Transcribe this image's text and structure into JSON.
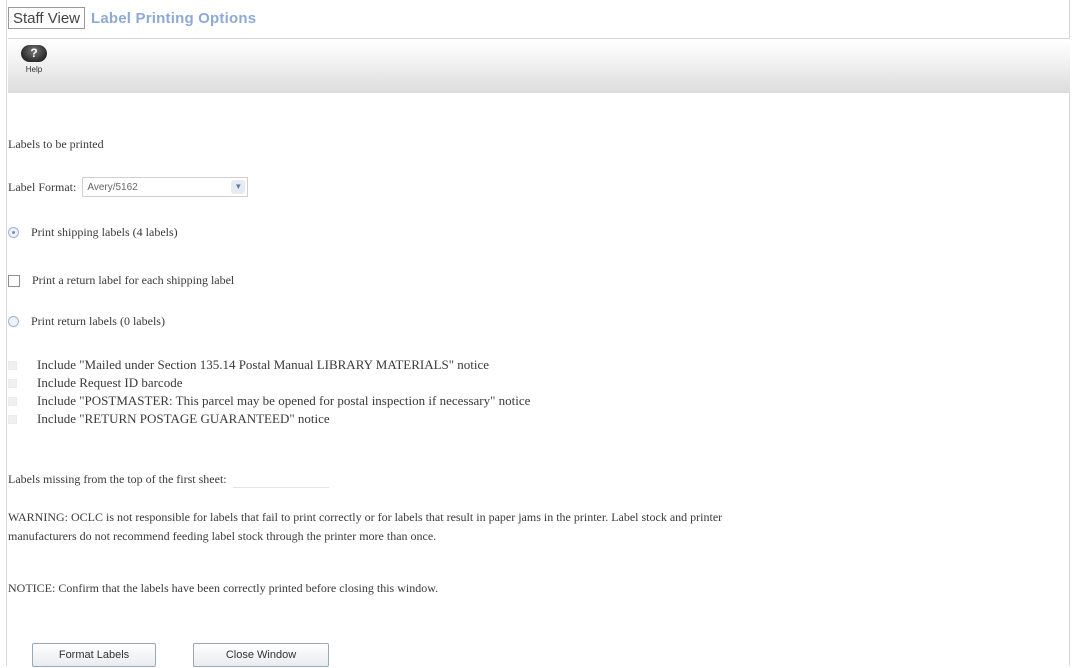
{
  "window": {
    "staff_view_tab": "Staff View",
    "page_title": "Label Printing Options"
  },
  "toolbar": {
    "help_label": "Help",
    "help_icon": "?"
  },
  "form": {
    "labels_to_be_printed": "Labels to be printed",
    "label_format_label": "Label Format:",
    "label_format_value": "Avery/5162",
    "print_shipping_labels": "Print shipping labels (4 labels)",
    "print_return_each": "Print a return label for each shipping label",
    "print_return_labels": "Print return labels (0 labels)",
    "include_options": [
      "Include \"Mailed under Section 135.14 Postal Manual LIBRARY MATERIALS\" notice",
      "Include Request ID barcode",
      "Include \"POSTMASTER: This parcel may be opened for postal inspection if necessary\" notice",
      "Include \"RETURN POSTAGE GUARANTEED\" notice"
    ],
    "labels_missing_label": "Labels missing from the top of the first sheet:",
    "labels_missing_value": ""
  },
  "messages": {
    "warning_line1": "WARNING: OCLC is not responsible for labels that fail to print correctly or for labels that result in paper jams in the printer. Label stock and printer",
    "warning_line2": "manufacturers do not recommend feeding label stock through the printer more than once.",
    "notice": "NOTICE: Confirm that the labels have been correctly printed before closing this window."
  },
  "buttons": {
    "format_labels": "Format Labels",
    "close_window": "Close Window"
  },
  "colors": {
    "title_blue": "#8fa9d6",
    "toolbar_gray": "#dcdcdc"
  }
}
